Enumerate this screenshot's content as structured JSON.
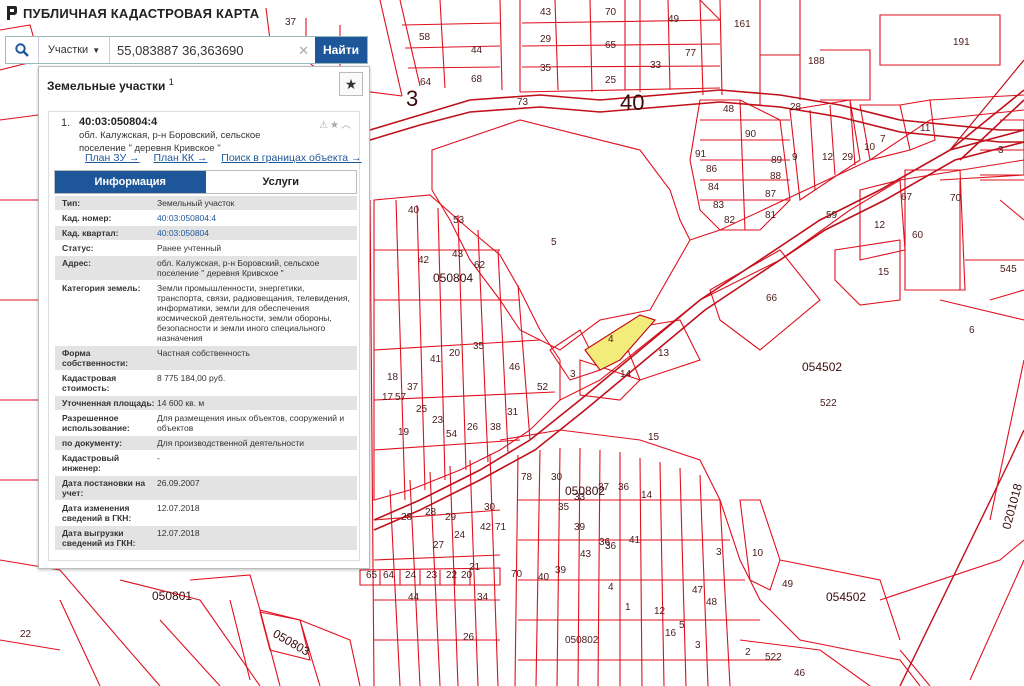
{
  "header": {
    "app_title": "ПУБЛИЧНАЯ КАДАСТРОВАЯ КАРТА"
  },
  "search": {
    "scope": "Участки",
    "query": "55,083887 36,363690",
    "submit_label": "Найти"
  },
  "panel": {
    "title": "Земельные участки",
    "title_footnote": "1",
    "result": {
      "index": "1.",
      "cad_number": "40:03:050804:4",
      "address_line1": "обл. Калужская, р-н Боровский, сельское",
      "address_line2": "поселение \" деревня Кривское \"",
      "links": [
        "План ЗУ →",
        "План КК →",
        "Поиск в границах объекта →"
      ],
      "tabs": [
        "Информация",
        "Услуги"
      ],
      "attributes": [
        {
          "key": "Тип:",
          "value": "Земельный участок"
        },
        {
          "key": "Кад. номер:",
          "value": "40:03:050804:4",
          "link": true
        },
        {
          "key": "Кад. квартал:",
          "value": "40:03:050804",
          "link": true
        },
        {
          "key": "Статус:",
          "value": "Ранее учтенный"
        },
        {
          "key": "Адрес:",
          "value": "обл. Калужская, р-н Боровский, сельское поселение \" деревня Кривское \""
        },
        {
          "key": "Категория земель:",
          "value": "Земли промышленности, энергетики, транспорта, связи, радиовещания, телевидения, информатики, земли для обеспечения космической деятельности, земли обороны, безопасности и земли иного специального назначения"
        },
        {
          "key": "Форма собственности:",
          "value": "Частная собственность"
        },
        {
          "key": "Кадастровая стоимость:",
          "value": "8 775 184,00 руб."
        },
        {
          "key": "Уточненная площадь:",
          "value": "14 600 кв. м"
        },
        {
          "key": "Разрешенное использование:",
          "value": "Для размещения иных объектов, сооружений и объектов"
        },
        {
          "key": "по документу:",
          "value": "Для производственной деятельности"
        },
        {
          "key": "Кадастровый инженер:",
          "value": "-"
        },
        {
          "key": "Дата постановки на учет:",
          "value": "26.09.2007"
        },
        {
          "key": "Дата изменения сведений в ГКН:",
          "value": "12.07.2018"
        },
        {
          "key": "Дата выгрузки сведений из ГКН:",
          "value": "12.07.2018"
        }
      ]
    }
  },
  "map": {
    "colors": {
      "parcel_line": "#e0101f",
      "road_line": "#c0101a",
      "selected_fill": "#f4ec7a"
    },
    "quarter_labels": [
      "050804",
      "054502",
      "050802",
      "050801",
      "050803",
      "054502",
      "0201018"
    ],
    "road_labels": [
      "40",
      "3"
    ],
    "parcel_numbers": [
      "37",
      "43",
      "70",
      "49",
      "161",
      "58",
      "44",
      "29",
      "65",
      "33",
      "77",
      "191",
      "64",
      "68",
      "35",
      "25",
      "73",
      "188",
      "48",
      "11",
      "3",
      "91",
      "86",
      "84",
      "83",
      "82",
      "81",
      "87",
      "88",
      "89",
      "90",
      "28",
      "9",
      "12",
      "29",
      "10",
      "7",
      "53",
      "40",
      "42",
      "43",
      "62",
      "5",
      "59",
      "67",
      "12",
      "60",
      "70",
      "545",
      "15",
      "66",
      "6",
      "22",
      "4",
      "13",
      "3",
      "14",
      "52",
      "35",
      "46",
      "31",
      "38",
      "26",
      "54",
      "23",
      "25",
      "37",
      "41",
      "20",
      "57",
      "19",
      "18",
      "17",
      "15",
      "78",
      "30",
      "35",
      "33",
      "39",
      "37",
      "36",
      "14",
      "522",
      "050802",
      "10",
      "3",
      "21",
      "34",
      "26",
      "44",
      "29",
      "30",
      "28",
      "28",
      "27",
      "24",
      "42",
      "71",
      "70",
      "40",
      "39",
      "43",
      "36",
      "36",
      "41",
      "4",
      "1",
      "12",
      "16",
      "5",
      "3",
      "2",
      "522",
      "46",
      "47",
      "48",
      "49",
      "65",
      "64",
      "24",
      "23",
      "22",
      "20"
    ]
  }
}
